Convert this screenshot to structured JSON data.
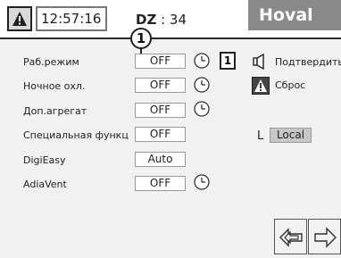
{
  "header": {
    "warning_icon": "warning-triangle-icon",
    "time": "12:57:16",
    "dz_label": "DZ",
    "dz_value": ": 34",
    "brand": "Hoval"
  },
  "marker": {
    "number": "1"
  },
  "rows": [
    {
      "label": "Раб.режим",
      "value": "OFF"
    },
    {
      "label": "Ночное охл.",
      "value": "OFF"
    },
    {
      "label": "Доп.агрегат",
      "value": "OFF"
    },
    {
      "label": "Специальная функц",
      "value": "OFF"
    },
    {
      "label": "DigiEasy",
      "value": "Auto"
    },
    {
      "label": "AdiaVent",
      "value": "OFF"
    }
  ],
  "day_button": "1",
  "actions": {
    "confirm_label": "Подтвердить",
    "confirm_icon": "speaker-confirm-icon",
    "reset_label": "Сброс",
    "reset_icon": "warning-triangle-icon"
  },
  "local": {
    "letter": "L",
    "button": "Local"
  },
  "nav": {
    "prev_icon": "double-arrow-left-icon",
    "next_icon": "arrow-right-icon"
  }
}
